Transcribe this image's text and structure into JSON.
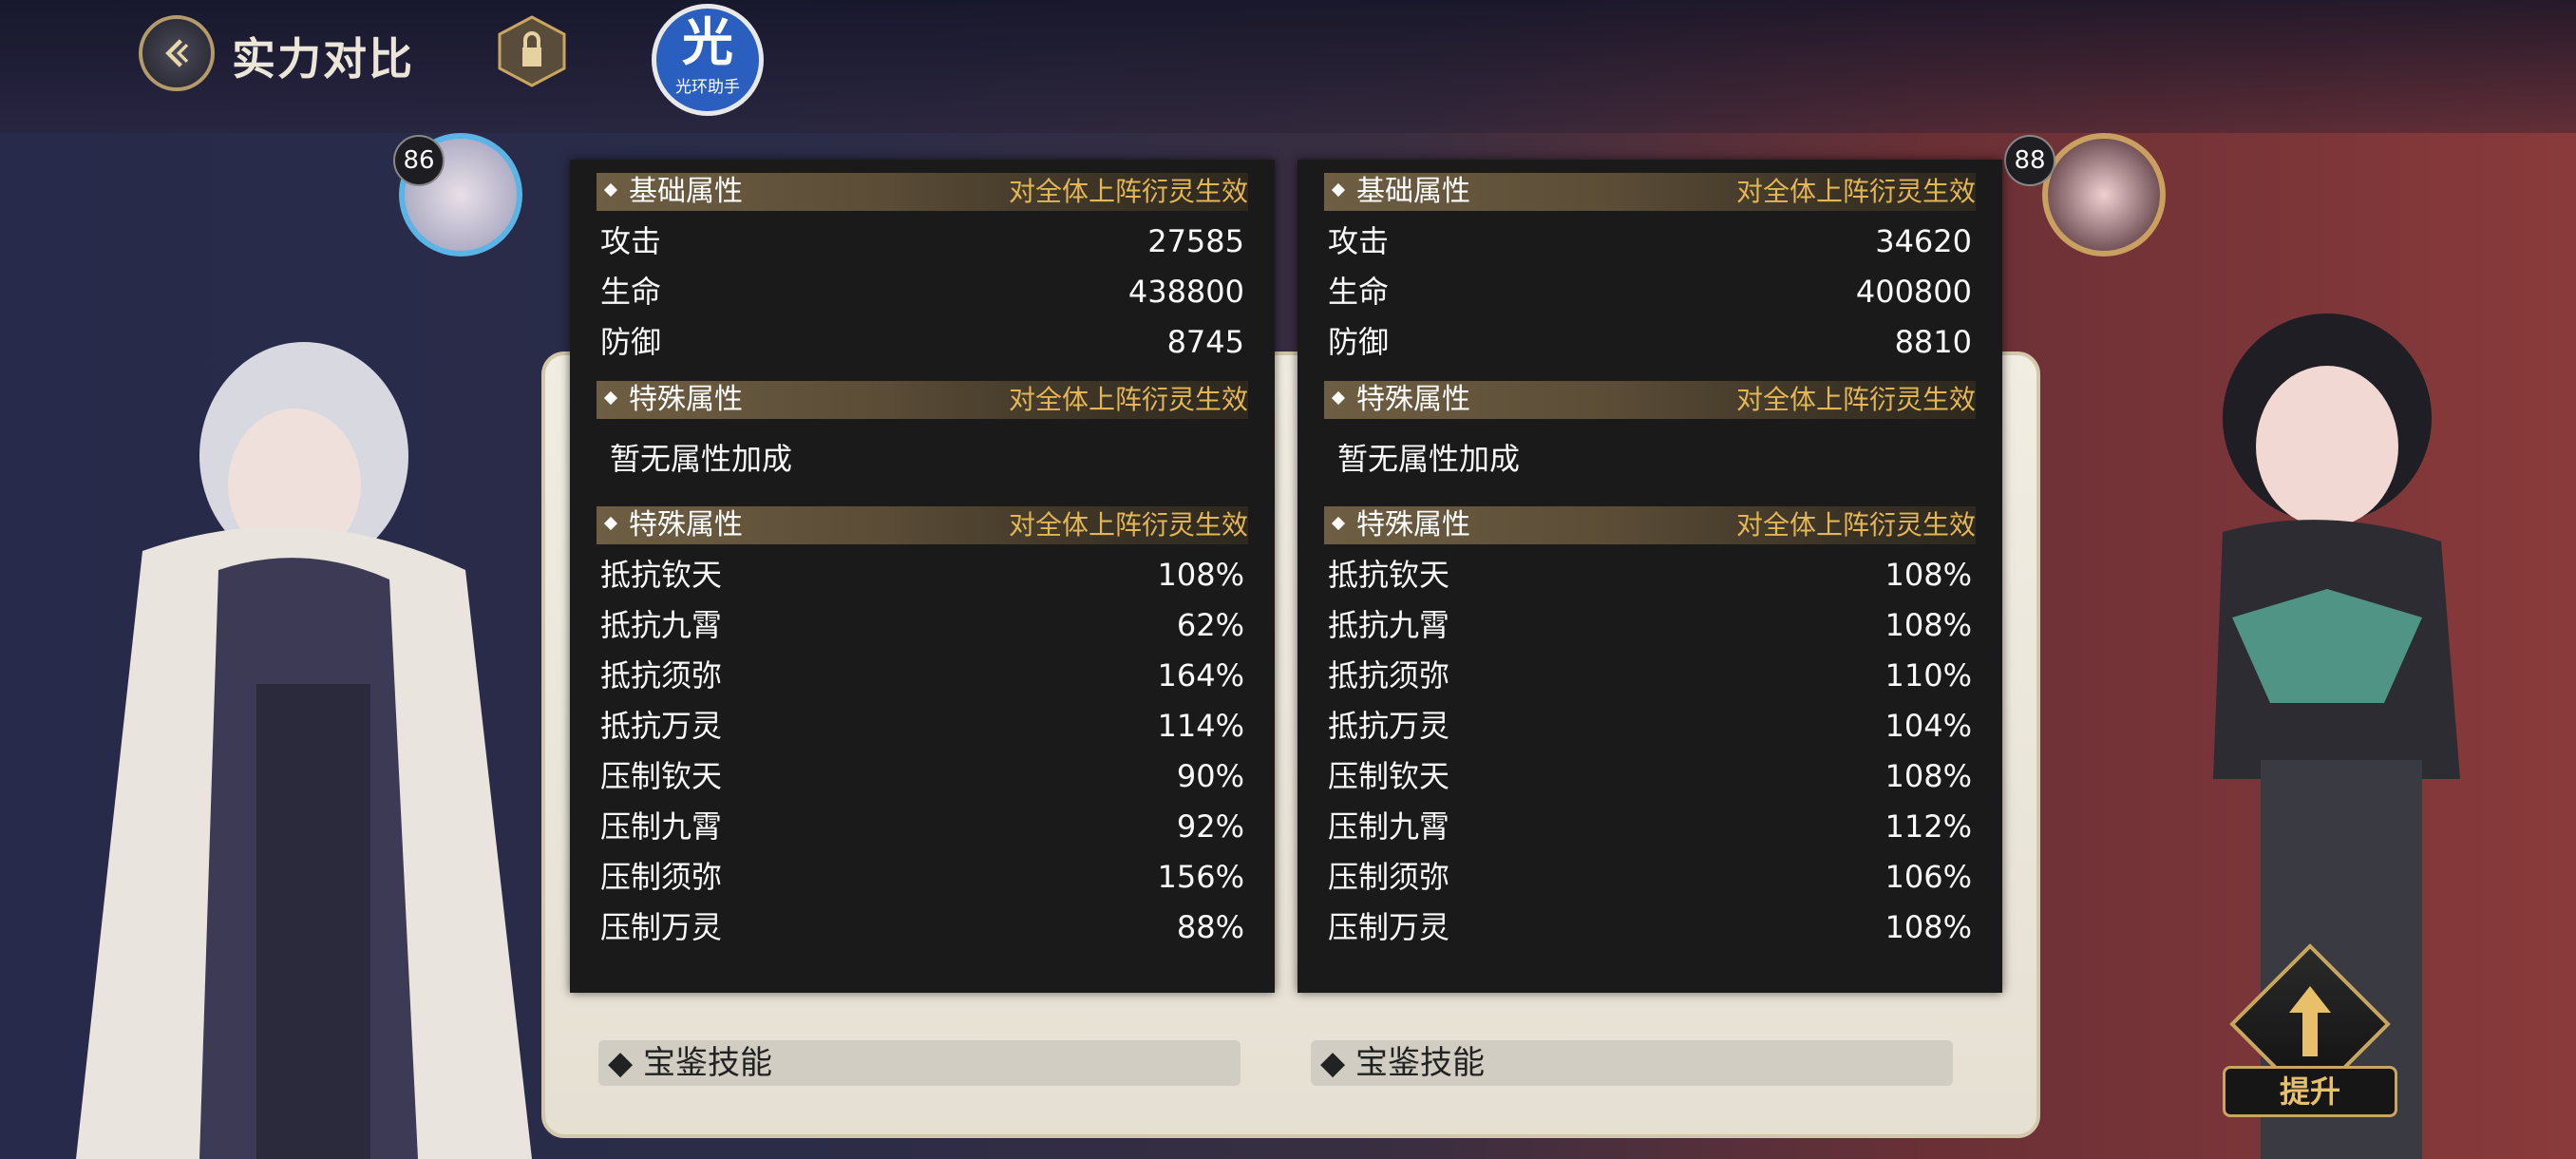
{
  "header": {
    "title": "实力对比",
    "helper_big": "光",
    "helper_small": "光环助手"
  },
  "left": {
    "level": "86",
    "base_section": {
      "title": "基础属性",
      "note": "对全体上阵衍灵生效"
    },
    "base_stats": [
      {
        "label": "攻击",
        "value": "27585"
      },
      {
        "label": "生命",
        "value": "438800"
      },
      {
        "label": "防御",
        "value": "8745"
      }
    ],
    "special_section_1": {
      "title": "特殊属性",
      "note": "对全体上阵衍灵生效",
      "empty": "暂无属性加成"
    },
    "special_section_2": {
      "title": "特殊属性",
      "note": "对全体上阵衍灵生效"
    },
    "special_stats": [
      {
        "label": "抵抗钦天",
        "value": "108%"
      },
      {
        "label": "抵抗九霄",
        "value": "62%"
      },
      {
        "label": "抵抗须弥",
        "value": "164%"
      },
      {
        "label": "抵抗万灵",
        "value": "114%"
      },
      {
        "label": "压制钦天",
        "value": "90%"
      },
      {
        "label": "压制九霄",
        "value": "92%"
      },
      {
        "label": "压制须弥",
        "value": "156%"
      },
      {
        "label": "压制万灵",
        "value": "88%"
      }
    ],
    "skill_label": "宝鉴技能"
  },
  "right": {
    "level": "88",
    "base_section": {
      "title": "基础属性",
      "note": "对全体上阵衍灵生效"
    },
    "base_stats": [
      {
        "label": "攻击",
        "value": "34620"
      },
      {
        "label": "生命",
        "value": "400800"
      },
      {
        "label": "防御",
        "value": "8810"
      }
    ],
    "special_section_1": {
      "title": "特殊属性",
      "note": "对全体上阵衍灵生效",
      "empty": "暂无属性加成"
    },
    "special_section_2": {
      "title": "特殊属性",
      "note": "对全体上阵衍灵生效"
    },
    "special_stats": [
      {
        "label": "抵抗钦天",
        "value": "108%"
      },
      {
        "label": "抵抗九霄",
        "value": "108%"
      },
      {
        "label": "抵抗须弥",
        "value": "110%"
      },
      {
        "label": "抵抗万灵",
        "value": "104%"
      },
      {
        "label": "压制钦天",
        "value": "108%"
      },
      {
        "label": "压制九霄",
        "value": "112%"
      },
      {
        "label": "压制须弥",
        "value": "106%"
      },
      {
        "label": "压制万灵",
        "value": "108%"
      }
    ],
    "skill_label": "宝鉴技能"
  },
  "upgrade_button": {
    "label": "提升"
  },
  "colors": {
    "accent_gold": "#e3b657",
    "popup_bg": "#1a1a1a"
  },
  "icons": {
    "back": "back-arrow-icon",
    "lock": "lock-icon",
    "upgrade": "up-arrow-icon"
  }
}
